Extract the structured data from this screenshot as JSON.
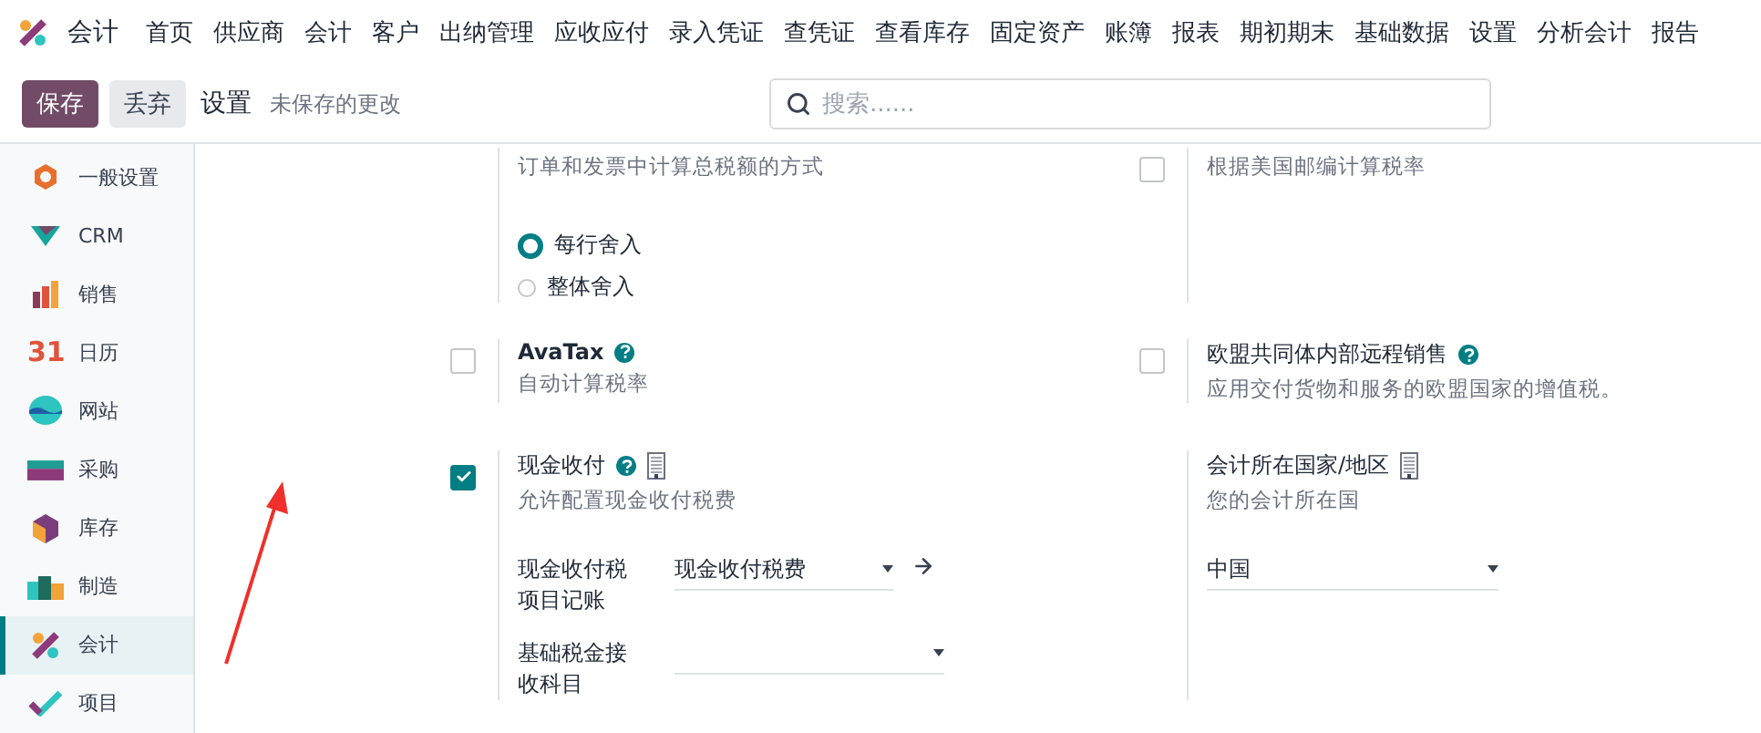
{
  "navbar": {
    "app": "会计",
    "menu": [
      "首页",
      "供应商",
      "会计",
      "客户",
      "出纳管理",
      "应收应付",
      "录入凭证",
      "查凭证",
      "查看库存",
      "固定资产",
      "账簿",
      "报表",
      "期初期末",
      "基础数据",
      "设置",
      "分析会计",
      "报告"
    ]
  },
  "control_bar": {
    "save": "保存",
    "discard": "丢弃",
    "title": "设置",
    "status": "未保存的更改",
    "search": {
      "placeholder": "搜索......"
    }
  },
  "sidebar": {
    "items": [
      {
        "label": "一般设置",
        "kind": "general",
        "selected": false
      },
      {
        "label": "CRM",
        "kind": "crm",
        "selected": false
      },
      {
        "label": "销售",
        "kind": "sales",
        "selected": false
      },
      {
        "label": "日历",
        "kind": "calendar",
        "selected": false,
        "icon_text": "31"
      },
      {
        "label": "网站",
        "kind": "website",
        "selected": false
      },
      {
        "label": "采购",
        "kind": "purchase",
        "selected": false
      },
      {
        "label": "库存",
        "kind": "inventory",
        "selected": false
      },
      {
        "label": "制造",
        "kind": "manufacturing",
        "selected": false
      },
      {
        "label": "会计",
        "kind": "accounting",
        "selected": true
      },
      {
        "label": "项目",
        "kind": "project",
        "selected": false
      }
    ]
  },
  "settings": [
    [
      {
        "checkbox": false,
        "description": "订单和发票中计算总税额的方式",
        "radios": [
          {
            "label": "每行舍入",
            "selected": true
          },
          {
            "label": "整体舍入",
            "selected": false
          }
        ]
      },
      {
        "checkbox": true,
        "checked": false,
        "description": "根据美国邮编计算税率"
      }
    ],
    [
      {
        "checkbox": true,
        "checked": false,
        "title": "AvaTax",
        "bold": true,
        "help": true,
        "description": "自动计算税率"
      },
      {
        "checkbox": true,
        "checked": false,
        "title": "欧盟共同体内部远程销售",
        "help": true,
        "description": "应用交付货物和服务的欧盟国家的增值税。"
      }
    ],
    [
      {
        "checkbox": true,
        "checked": true,
        "title": "现金收付",
        "help": true,
        "company": true,
        "description": "允许配置现金收付税费",
        "fields": [
          {
            "label": "现金收付税项目记账",
            "value": "现金收付税费",
            "link": true
          },
          {
            "label": "基础税金接收科目"
          }
        ]
      },
      {
        "checkbox": false,
        "title": "会计所在国家/地区",
        "company": true,
        "description": "您的会计所在国",
        "fields": [
          {
            "value": "中国"
          }
        ]
      }
    ]
  ],
  "annotation": {
    "kind": "arrow"
  }
}
